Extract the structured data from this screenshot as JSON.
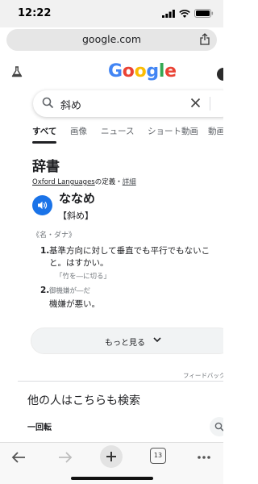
{
  "status": {
    "time": "12:22"
  },
  "browser": {
    "url": "google.com",
    "tab_count": "13"
  },
  "google": {
    "logo_letters": [
      {
        "ch": "G",
        "color": "#4285F4"
      },
      {
        "ch": "o",
        "color": "#EA4335"
      },
      {
        "ch": "o",
        "color": "#FBBC05"
      },
      {
        "ch": "g",
        "color": "#4285F4"
      },
      {
        "ch": "l",
        "color": "#34A853"
      },
      {
        "ch": "e",
        "color": "#EA4335"
      }
    ]
  },
  "search": {
    "query": "斜め"
  },
  "tabs": [
    "すべて",
    "画像",
    "ニュース",
    "ショート動画",
    "動画"
  ],
  "dictionary": {
    "heading": "辞書",
    "source_prefix": "Oxford Languages",
    "source_suffix": "の定義・",
    "source_detail": "詳細",
    "word": "ななめ",
    "kanji": "【斜め】",
    "part_of_speech": "《名・ダナ》",
    "definitions": [
      {
        "num": "1.",
        "line1": "基準方向に対して垂直でも平行でもないこ",
        "line2": "と。はすかい。",
        "example": "「竹を―に切る」"
      },
      {
        "num": "2.",
        "note": "御機嫌が―だ",
        "main": "機嫌が悪い。"
      }
    ],
    "more_button": "もっと見る",
    "feedback": "フィードバック"
  },
  "related": {
    "title": "他の人はこちらも検索",
    "first_item": "一回転"
  },
  "colors": {
    "accent": "#1a73e8",
    "text": "#202124",
    "muted": "#70757a"
  }
}
